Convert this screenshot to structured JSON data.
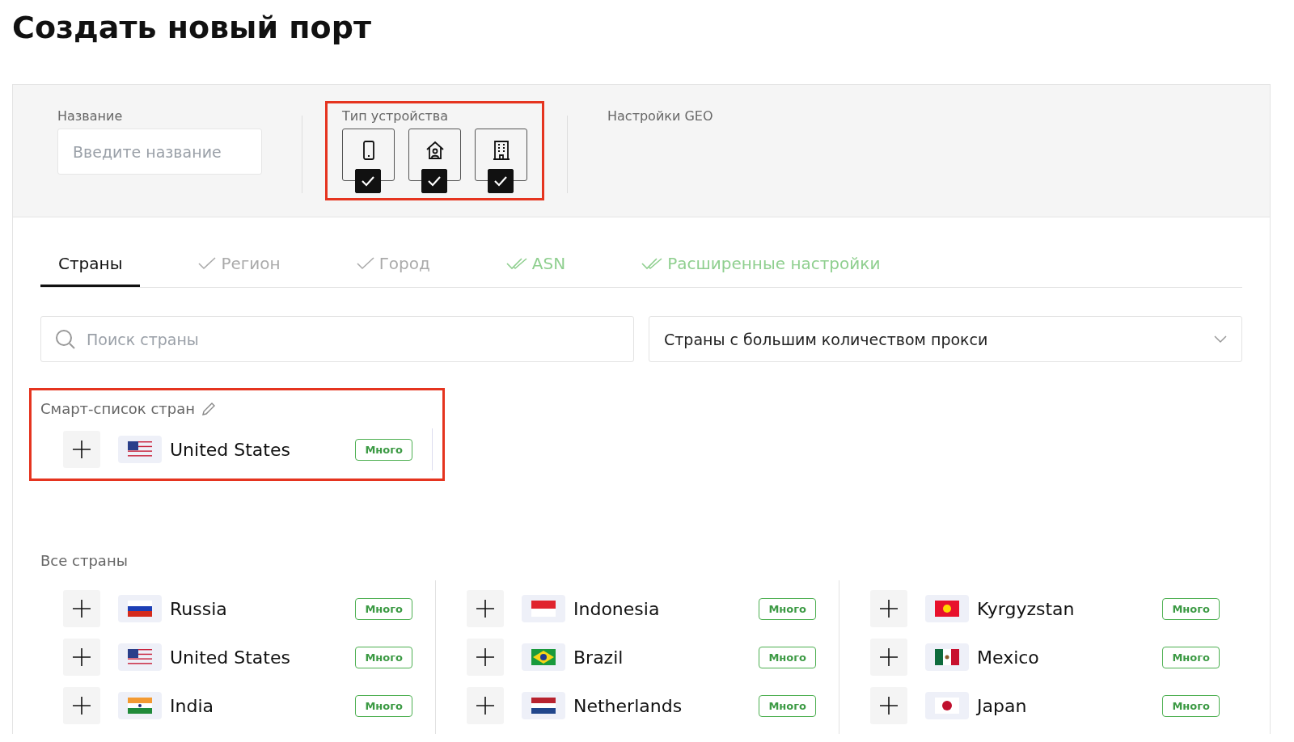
{
  "title": "Создать новый порт",
  "settings": {
    "name": {
      "label": "Название",
      "placeholder": "Введите название"
    },
    "device_type": {
      "label": "Тип устройства",
      "highlighted": true,
      "items": [
        {
          "kind": "mobile",
          "checked": true
        },
        {
          "kind": "home",
          "checked": true
        },
        {
          "kind": "office",
          "checked": true
        }
      ]
    },
    "geo": {
      "label": "Настройки GEO"
    }
  },
  "tabs": [
    {
      "label": "Страны",
      "selected": true,
      "kind": "plain"
    },
    {
      "label": "Регион",
      "selected": false,
      "kind": "check"
    },
    {
      "label": "Город",
      "selected": false,
      "kind": "check"
    },
    {
      "label": "ASN",
      "selected": false,
      "kind": "doublecheck"
    },
    {
      "label": "Расширенные настройки",
      "selected": false,
      "kind": "doublecheck"
    }
  ],
  "search": {
    "placeholder": "Поиск страны"
  },
  "filter": {
    "value": "Страны с большим количеством прокси"
  },
  "smart_list": {
    "title": "Смарт-список стран",
    "highlighted": true,
    "countries": [
      {
        "name": "United States",
        "kind": "us",
        "badge": "Много"
      }
    ]
  },
  "all_countries": {
    "title": "Все страны",
    "columns": [
      [
        {
          "name": "Russia",
          "kind": "ru",
          "badge": "Много"
        },
        {
          "name": "United States",
          "kind": "us",
          "badge": "Много"
        },
        {
          "name": "India",
          "kind": "in",
          "badge": "Много"
        }
      ],
      [
        {
          "name": "Indonesia",
          "kind": "id",
          "badge": "Много"
        },
        {
          "name": "Brazil",
          "kind": "br",
          "badge": "Много"
        },
        {
          "name": "Netherlands",
          "kind": "nl",
          "badge": "Много"
        }
      ],
      [
        {
          "name": "Kyrgyzstan",
          "kind": "kg",
          "badge": "Много"
        },
        {
          "name": "Mexico",
          "kind": "mx",
          "badge": "Много"
        },
        {
          "name": "Japan",
          "kind": "jp",
          "badge": "Много"
        }
      ]
    ]
  }
}
